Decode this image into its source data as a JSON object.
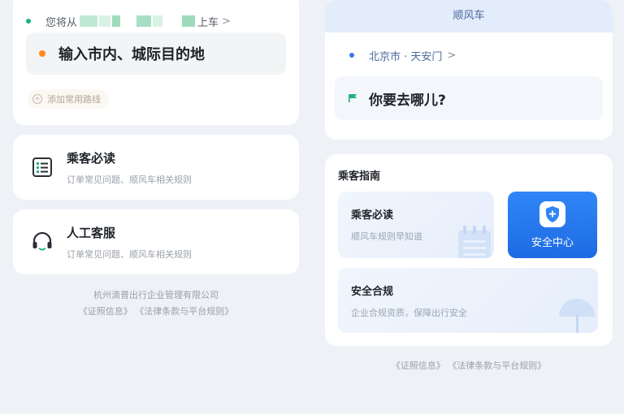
{
  "left": {
    "pickup": {
      "prefix": "您将从",
      "suffix": "上车",
      "chevron": ">"
    },
    "destination_prompt": "输入市内、城际目的地",
    "add_route": "添加常用路线",
    "passenger_card": {
      "title": "乘客必读",
      "subtitle": "订单常见问题、顺风车相关规则"
    },
    "service_card": {
      "title": "人工客服",
      "subtitle": "订单常见问题、顺风车相关规则"
    },
    "footer": {
      "company": "杭州滴普出行企业管理有限公司",
      "links": "《证照信息》 《法律条款与平台规则》"
    }
  },
  "right": {
    "header": "顺风车",
    "origin": "北京市 · 天安门",
    "origin_chevron": ">",
    "destination_prompt": "你要去哪儿?",
    "guide": {
      "title": "乘客指南",
      "reading": {
        "title": "乘客必读",
        "subtitle": "顺风车规则早知道"
      },
      "safety_center": "安全中心",
      "compliance": {
        "title": "安全合规",
        "subtitle": "企业合规资质，保障出行安全"
      }
    },
    "footer": "《证照信息》 《法律条款与平台规则》"
  },
  "colors": {
    "accent_blue": "#1e6be3",
    "green": "#1fb27a",
    "orange": "#ff8a1f",
    "page_bg": "#eef2f7"
  },
  "icons": [
    "list-doc-icon",
    "headset-icon",
    "plus-circle-icon",
    "flag-icon",
    "shield-plus-icon",
    "calendar-icon",
    "umbrella-icon"
  ]
}
